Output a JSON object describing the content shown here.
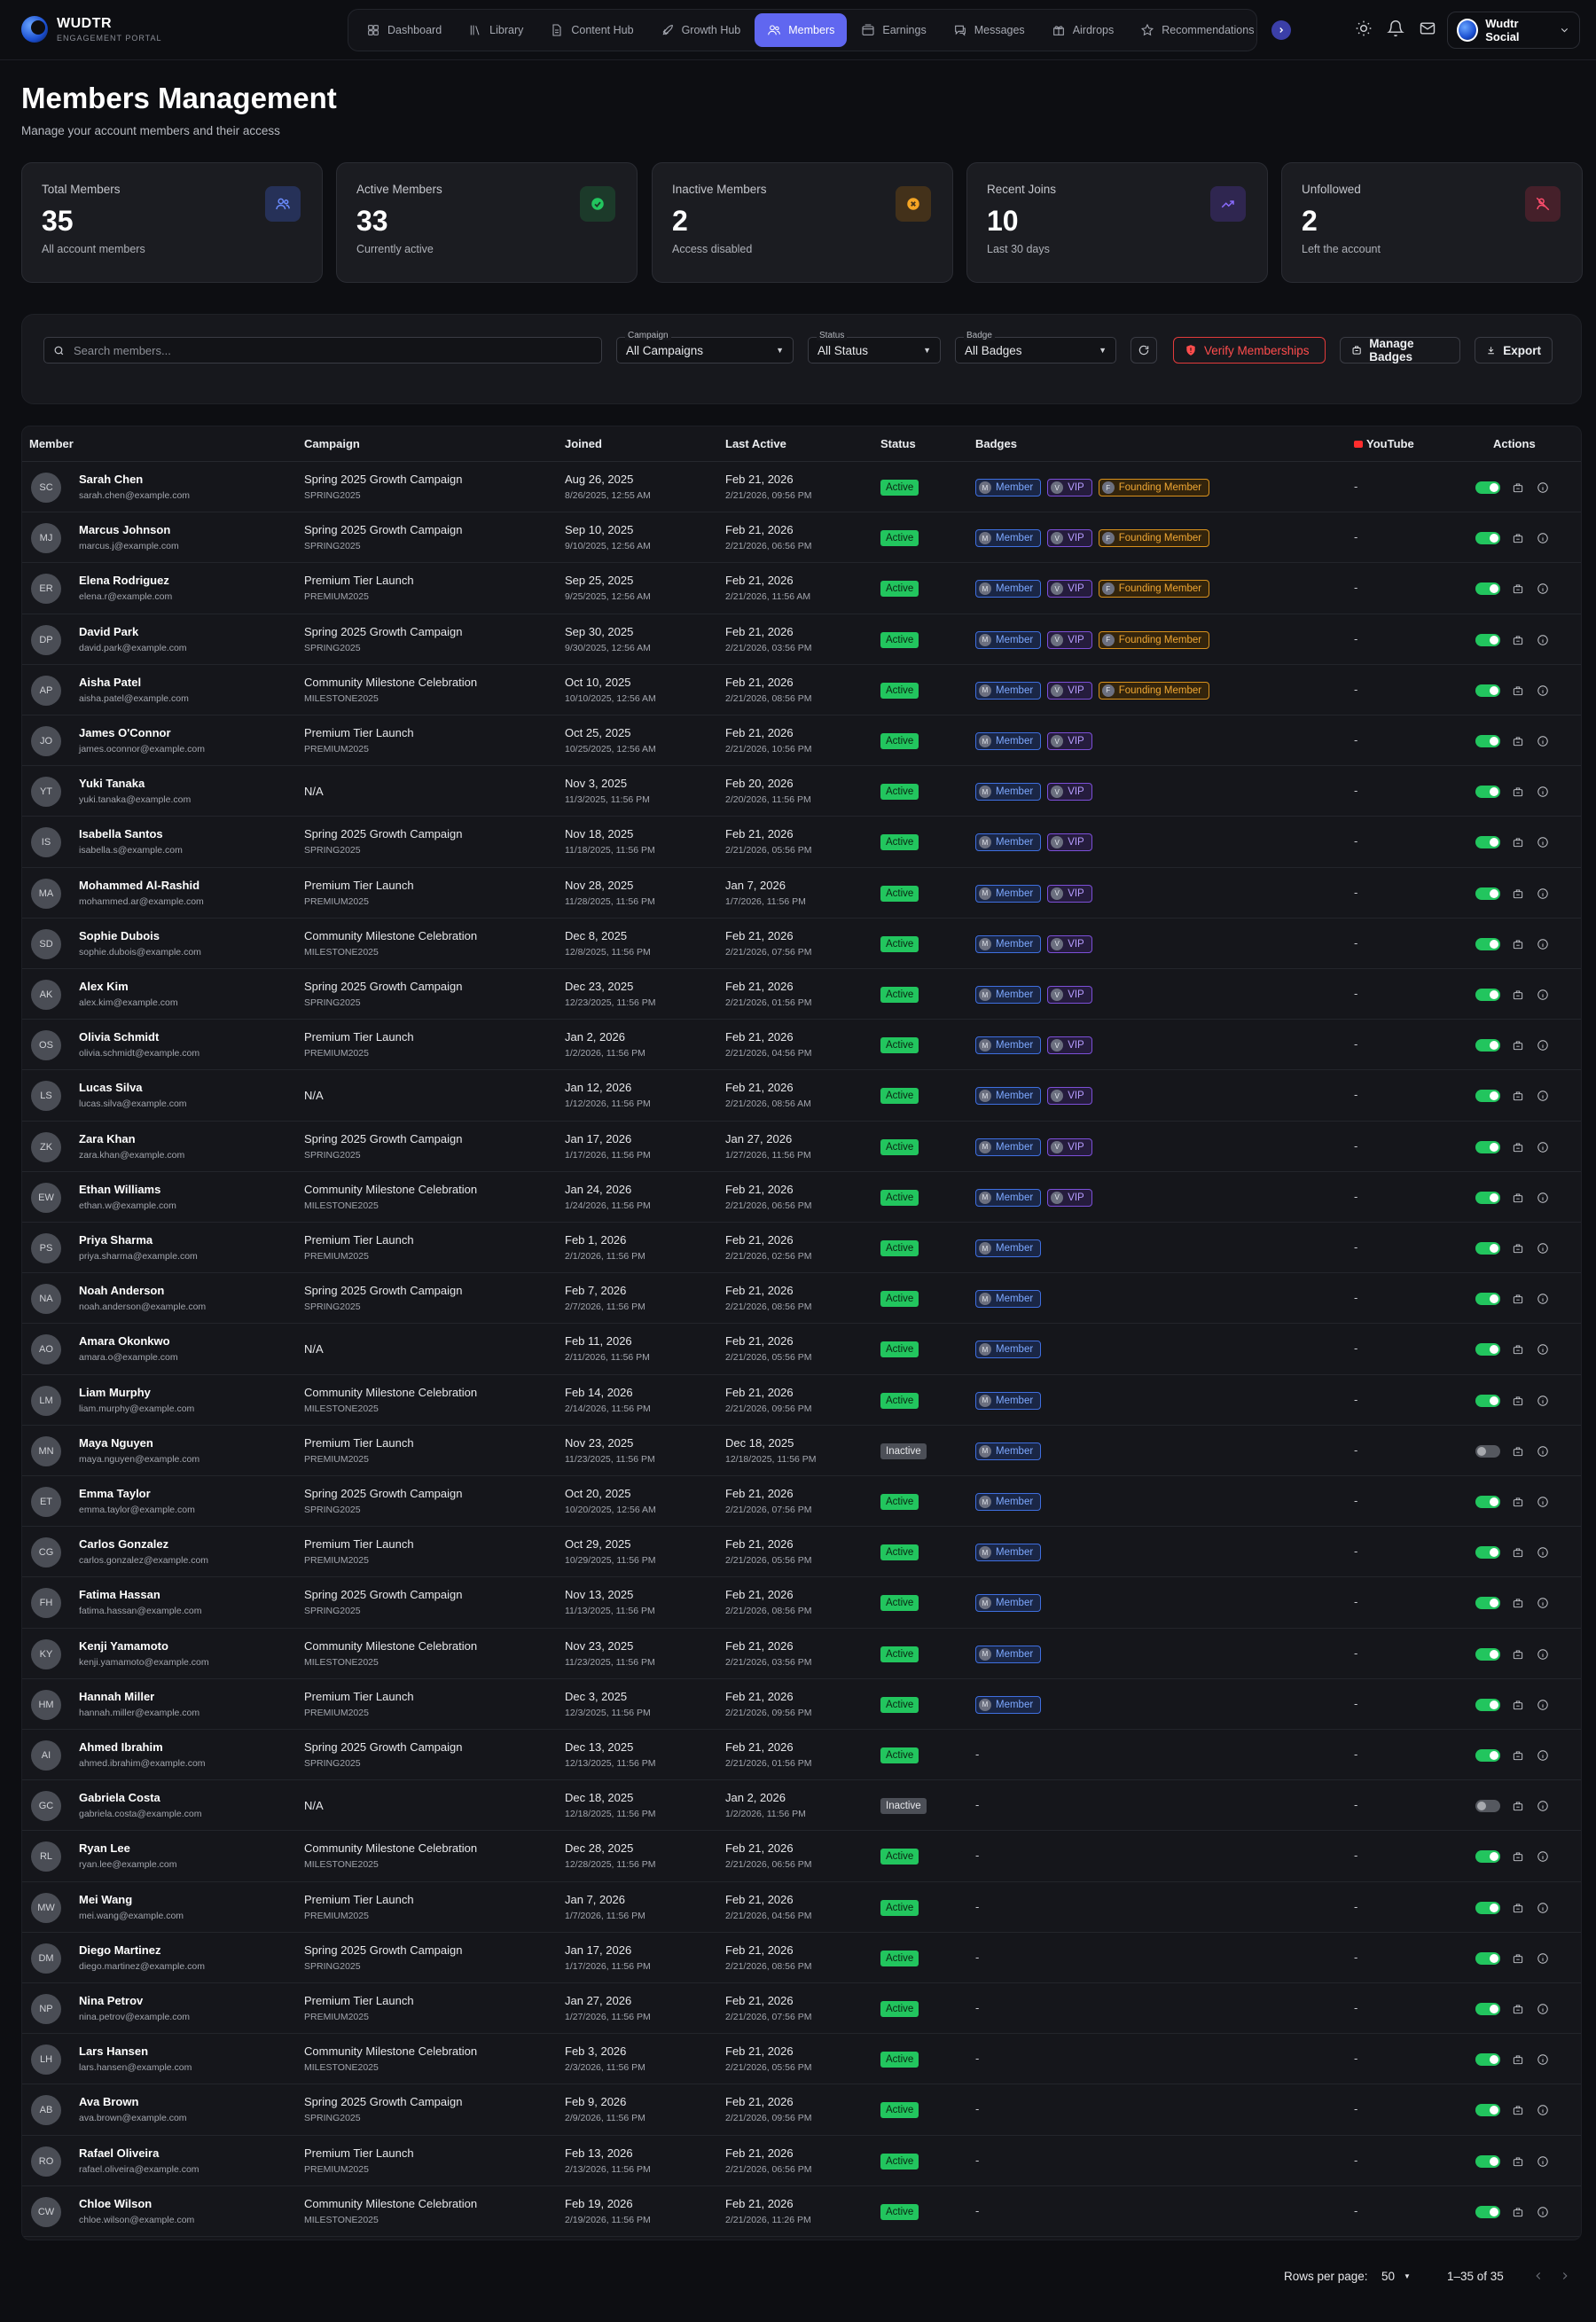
{
  "brand": {
    "name": "WUDTR",
    "tagline": "ENGAGEMENT PORTAL"
  },
  "nav": [
    {
      "label": "Dashboard",
      "icon": "grid-icon"
    },
    {
      "label": "Library",
      "icon": "library-icon"
    },
    {
      "label": "Content Hub",
      "icon": "document-icon"
    },
    {
      "label": "Growth Hub",
      "icon": "rocket-icon"
    },
    {
      "label": "Members",
      "icon": "users-icon",
      "active": true
    },
    {
      "label": "Earnings",
      "icon": "wallet-icon"
    },
    {
      "label": "Messages",
      "icon": "chat-icon"
    },
    {
      "label": "Airdrops",
      "icon": "gift-icon"
    },
    {
      "label": "Recommendations",
      "icon": "star-icon"
    }
  ],
  "account": {
    "name": "Wudtr Social"
  },
  "page": {
    "title": "Members Management",
    "subtitle": "Manage your account members and their access"
  },
  "stats": [
    {
      "label": "Total Members",
      "value": "35",
      "sub": "All account members",
      "icon": "users-icon",
      "color": "#6b8cff",
      "bg": "#263158"
    },
    {
      "label": "Active Members",
      "value": "33",
      "sub": "Currently active",
      "icon": "check-circle-icon",
      "color": "#22c55e",
      "bg": "#1c3a2a"
    },
    {
      "label": "Inactive Members",
      "value": "2",
      "sub": "Access disabled",
      "icon": "x-circle-icon",
      "color": "#f5a524",
      "bg": "#43311a"
    },
    {
      "label": "Recent Joins",
      "value": "10",
      "sub": "Last 30 days",
      "icon": "trend-up-icon",
      "color": "#8b6cff",
      "bg": "#2f2650"
    },
    {
      "label": "Unfollowed",
      "value": "2",
      "sub": "Left the account",
      "icon": "user-x-icon",
      "color": "#ff4d6d",
      "bg": "#45202a"
    }
  ],
  "filters": {
    "search_placeholder": "Search members...",
    "campaign": {
      "label": "Campaign",
      "value": "All Campaigns"
    },
    "status": {
      "label": "Status",
      "value": "All Status"
    },
    "badge": {
      "label": "Badge",
      "value": "All Badges"
    },
    "verify_label": "Verify Memberships",
    "manage_badges_label": "Manage Badges",
    "export_label": "Export"
  },
  "columns": {
    "member": "Member",
    "campaign": "Campaign",
    "joined": "Joined",
    "last_active": "Last Active",
    "status": "Status",
    "badges": "Badges",
    "youtube": "YouTube",
    "actions": "Actions"
  },
  "badge_labels": {
    "member": "Member",
    "vip": "VIP",
    "founding": "Founding Member",
    "member_initial": "M",
    "vip_initial": "V",
    "founding_initial": "F"
  },
  "rows": [
    {
      "initials": "SC",
      "name": "Sarah Chen",
      "email": "sarah.chen@example.com",
      "campaign": "Spring 2025 Growth Campaign",
      "code": "SPRING2025",
      "joined": "Aug 26, 2025",
      "joined_full": "8/26/2025, 12:55 AM",
      "last": "Feb 21, 2026",
      "last_full": "2/21/2026, 09:56 PM",
      "status": "Active",
      "badges": [
        "member",
        "vip",
        "founding"
      ],
      "youtube": "-",
      "enabled": true
    },
    {
      "initials": "MJ",
      "name": "Marcus Johnson",
      "email": "marcus.j@example.com",
      "campaign": "Spring 2025 Growth Campaign",
      "code": "SPRING2025",
      "joined": "Sep 10, 2025",
      "joined_full": "9/10/2025, 12:56 AM",
      "last": "Feb 21, 2026",
      "last_full": "2/21/2026, 06:56 PM",
      "status": "Active",
      "badges": [
        "member",
        "vip",
        "founding"
      ],
      "youtube": "-",
      "enabled": true
    },
    {
      "initials": "ER",
      "name": "Elena Rodriguez",
      "email": "elena.r@example.com",
      "campaign": "Premium Tier Launch",
      "code": "PREMIUM2025",
      "joined": "Sep 25, 2025",
      "joined_full": "9/25/2025, 12:56 AM",
      "last": "Feb 21, 2026",
      "last_full": "2/21/2026, 11:56 AM",
      "status": "Active",
      "badges": [
        "member",
        "vip",
        "founding"
      ],
      "youtube": "-",
      "enabled": true
    },
    {
      "initials": "DP",
      "name": "David Park",
      "email": "david.park@example.com",
      "campaign": "Spring 2025 Growth Campaign",
      "code": "SPRING2025",
      "joined": "Sep 30, 2025",
      "joined_full": "9/30/2025, 12:56 AM",
      "last": "Feb 21, 2026",
      "last_full": "2/21/2026, 03:56 PM",
      "status": "Active",
      "badges": [
        "member",
        "vip",
        "founding"
      ],
      "youtube": "-",
      "enabled": true
    },
    {
      "initials": "AP",
      "name": "Aisha Patel",
      "email": "aisha.patel@example.com",
      "campaign": "Community Milestone Celebration",
      "code": "MILESTONE2025",
      "joined": "Oct 10, 2025",
      "joined_full": "10/10/2025, 12:56 AM",
      "last": "Feb 21, 2026",
      "last_full": "2/21/2026, 08:56 PM",
      "status": "Active",
      "badges": [
        "member",
        "vip",
        "founding"
      ],
      "youtube": "-",
      "enabled": true
    },
    {
      "initials": "JO",
      "name": "James O'Connor",
      "email": "james.oconnor@example.com",
      "campaign": "Premium Tier Launch",
      "code": "PREMIUM2025",
      "joined": "Oct 25, 2025",
      "joined_full": "10/25/2025, 12:56 AM",
      "last": "Feb 21, 2026",
      "last_full": "2/21/2026, 10:56 PM",
      "status": "Active",
      "badges": [
        "member",
        "vip"
      ],
      "youtube": "-",
      "enabled": true
    },
    {
      "initials": "YT",
      "name": "Yuki Tanaka",
      "email": "yuki.tanaka@example.com",
      "campaign": "N/A",
      "code": "",
      "joined": "Nov 3, 2025",
      "joined_full": "11/3/2025, 11:56 PM",
      "last": "Feb 20, 2026",
      "last_full": "2/20/2026, 11:56 PM",
      "status": "Active",
      "badges": [
        "member",
        "vip"
      ],
      "youtube": "-",
      "enabled": true
    },
    {
      "initials": "IS",
      "name": "Isabella Santos",
      "email": "isabella.s@example.com",
      "campaign": "Spring 2025 Growth Campaign",
      "code": "SPRING2025",
      "joined": "Nov 18, 2025",
      "joined_full": "11/18/2025, 11:56 PM",
      "last": "Feb 21, 2026",
      "last_full": "2/21/2026, 05:56 PM",
      "status": "Active",
      "badges": [
        "member",
        "vip"
      ],
      "youtube": "-",
      "enabled": true
    },
    {
      "initials": "MA",
      "name": "Mohammed Al-Rashid",
      "email": "mohammed.ar@example.com",
      "campaign": "Premium Tier Launch",
      "code": "PREMIUM2025",
      "joined": "Nov 28, 2025",
      "joined_full": "11/28/2025, 11:56 PM",
      "last": "Jan 7, 2026",
      "last_full": "1/7/2026, 11:56 PM",
      "status": "Active",
      "badges": [
        "member",
        "vip"
      ],
      "youtube": "-",
      "enabled": true
    },
    {
      "initials": "SD",
      "name": "Sophie Dubois",
      "email": "sophie.dubois@example.com",
      "campaign": "Community Milestone Celebration",
      "code": "MILESTONE2025",
      "joined": "Dec 8, 2025",
      "joined_full": "12/8/2025, 11:56 PM",
      "last": "Feb 21, 2026",
      "last_full": "2/21/2026, 07:56 PM",
      "status": "Active",
      "badges": [
        "member",
        "vip"
      ],
      "youtube": "-",
      "enabled": true
    },
    {
      "initials": "AK",
      "name": "Alex Kim",
      "email": "alex.kim@example.com",
      "campaign": "Spring 2025 Growth Campaign",
      "code": "SPRING2025",
      "joined": "Dec 23, 2025",
      "joined_full": "12/23/2025, 11:56 PM",
      "last": "Feb 21, 2026",
      "last_full": "2/21/2026, 01:56 PM",
      "status": "Active",
      "badges": [
        "member",
        "vip"
      ],
      "youtube": "-",
      "enabled": true
    },
    {
      "initials": "OS",
      "name": "Olivia Schmidt",
      "email": "olivia.schmidt@example.com",
      "campaign": "Premium Tier Launch",
      "code": "PREMIUM2025",
      "joined": "Jan 2, 2026",
      "joined_full": "1/2/2026, 11:56 PM",
      "last": "Feb 21, 2026",
      "last_full": "2/21/2026, 04:56 PM",
      "status": "Active",
      "badges": [
        "member",
        "vip"
      ],
      "youtube": "-",
      "enabled": true
    },
    {
      "initials": "LS",
      "name": "Lucas Silva",
      "email": "lucas.silva@example.com",
      "campaign": "N/A",
      "code": "",
      "joined": "Jan 12, 2026",
      "joined_full": "1/12/2026, 11:56 PM",
      "last": "Feb 21, 2026",
      "last_full": "2/21/2026, 08:56 AM",
      "status": "Active",
      "badges": [
        "member",
        "vip"
      ],
      "youtube": "-",
      "enabled": true
    },
    {
      "initials": "ZK",
      "name": "Zara Khan",
      "email": "zara.khan@example.com",
      "campaign": "Spring 2025 Growth Campaign",
      "code": "SPRING2025",
      "joined": "Jan 17, 2026",
      "joined_full": "1/17/2026, 11:56 PM",
      "last": "Jan 27, 2026",
      "last_full": "1/27/2026, 11:56 PM",
      "status": "Active",
      "badges": [
        "member",
        "vip"
      ],
      "youtube": "-",
      "enabled": true
    },
    {
      "initials": "EW",
      "name": "Ethan Williams",
      "email": "ethan.w@example.com",
      "campaign": "Community Milestone Celebration",
      "code": "MILESTONE2025",
      "joined": "Jan 24, 2026",
      "joined_full": "1/24/2026, 11:56 PM",
      "last": "Feb 21, 2026",
      "last_full": "2/21/2026, 06:56 PM",
      "status": "Active",
      "badges": [
        "member",
        "vip"
      ],
      "youtube": "-",
      "enabled": true
    },
    {
      "initials": "PS",
      "name": "Priya Sharma",
      "email": "priya.sharma@example.com",
      "campaign": "Premium Tier Launch",
      "code": "PREMIUM2025",
      "joined": "Feb 1, 2026",
      "joined_full": "2/1/2026, 11:56 PM",
      "last": "Feb 21, 2026",
      "last_full": "2/21/2026, 02:56 PM",
      "status": "Active",
      "badges": [
        "member"
      ],
      "youtube": "-",
      "enabled": true
    },
    {
      "initials": "NA",
      "name": "Noah Anderson",
      "email": "noah.anderson@example.com",
      "campaign": "Spring 2025 Growth Campaign",
      "code": "SPRING2025",
      "joined": "Feb 7, 2026",
      "joined_full": "2/7/2026, 11:56 PM",
      "last": "Feb 21, 2026",
      "last_full": "2/21/2026, 08:56 PM",
      "status": "Active",
      "badges": [
        "member"
      ],
      "youtube": "-",
      "enabled": true
    },
    {
      "initials": "AO",
      "name": "Amara Okonkwo",
      "email": "amara.o@example.com",
      "campaign": "N/A",
      "code": "",
      "joined": "Feb 11, 2026",
      "joined_full": "2/11/2026, 11:56 PM",
      "last": "Feb 21, 2026",
      "last_full": "2/21/2026, 05:56 PM",
      "status": "Active",
      "badges": [
        "member"
      ],
      "youtube": "-",
      "enabled": true
    },
    {
      "initials": "LM",
      "name": "Liam Murphy",
      "email": "liam.murphy@example.com",
      "campaign": "Community Milestone Celebration",
      "code": "MILESTONE2025",
      "joined": "Feb 14, 2026",
      "joined_full": "2/14/2026, 11:56 PM",
      "last": "Feb 21, 2026",
      "last_full": "2/21/2026, 09:56 PM",
      "status": "Active",
      "badges": [
        "member"
      ],
      "youtube": "-",
      "enabled": true
    },
    {
      "initials": "MN",
      "name": "Maya Nguyen",
      "email": "maya.nguyen@example.com",
      "campaign": "Premium Tier Launch",
      "code": "PREMIUM2025",
      "joined": "Nov 23, 2025",
      "joined_full": "11/23/2025, 11:56 PM",
      "last": "Dec 18, 2025",
      "last_full": "12/18/2025, 11:56 PM",
      "status": "Inactive",
      "badges": [
        "member"
      ],
      "youtube": "-",
      "enabled": false
    },
    {
      "initials": "ET",
      "name": "Emma Taylor",
      "email": "emma.taylor@example.com",
      "campaign": "Spring 2025 Growth Campaign",
      "code": "SPRING2025",
      "joined": "Oct 20, 2025",
      "joined_full": "10/20/2025, 12:56 AM",
      "last": "Feb 21, 2026",
      "last_full": "2/21/2026, 07:56 PM",
      "status": "Active",
      "badges": [
        "member"
      ],
      "youtube": "-",
      "enabled": true
    },
    {
      "initials": "CG",
      "name": "Carlos Gonzalez",
      "email": "carlos.gonzalez@example.com",
      "campaign": "Premium Tier Launch",
      "code": "PREMIUM2025",
      "joined": "Oct 29, 2025",
      "joined_full": "10/29/2025, 11:56 PM",
      "last": "Feb 21, 2026",
      "last_full": "2/21/2026, 05:56 PM",
      "status": "Active",
      "badges": [
        "member"
      ],
      "youtube": "-",
      "enabled": true
    },
    {
      "initials": "FH",
      "name": "Fatima Hassan",
      "email": "fatima.hassan@example.com",
      "campaign": "Spring 2025 Growth Campaign",
      "code": "SPRING2025",
      "joined": "Nov 13, 2025",
      "joined_full": "11/13/2025, 11:56 PM",
      "last": "Feb 21, 2026",
      "last_full": "2/21/2026, 08:56 PM",
      "status": "Active",
      "badges": [
        "member"
      ],
      "youtube": "-",
      "enabled": true
    },
    {
      "initials": "KY",
      "name": "Kenji Yamamoto",
      "email": "kenji.yamamoto@example.com",
      "campaign": "Community Milestone Celebration",
      "code": "MILESTONE2025",
      "joined": "Nov 23, 2025",
      "joined_full": "11/23/2025, 11:56 PM",
      "last": "Feb 21, 2026",
      "last_full": "2/21/2026, 03:56 PM",
      "status": "Active",
      "badges": [
        "member"
      ],
      "youtube": "-",
      "enabled": true
    },
    {
      "initials": "HM",
      "name": "Hannah Miller",
      "email": "hannah.miller@example.com",
      "campaign": "Premium Tier Launch",
      "code": "PREMIUM2025",
      "joined": "Dec 3, 2025",
      "joined_full": "12/3/2025, 11:56 PM",
      "last": "Feb 21, 2026",
      "last_full": "2/21/2026, 09:56 PM",
      "status": "Active",
      "badges": [
        "member"
      ],
      "youtube": "-",
      "enabled": true
    },
    {
      "initials": "AI",
      "name": "Ahmed Ibrahim",
      "email": "ahmed.ibrahim@example.com",
      "campaign": "Spring 2025 Growth Campaign",
      "code": "SPRING2025",
      "joined": "Dec 13, 2025",
      "joined_full": "12/13/2025, 11:56 PM",
      "last": "Feb 21, 2026",
      "last_full": "2/21/2026, 01:56 PM",
      "status": "Active",
      "badges": [],
      "youtube": "-",
      "enabled": true
    },
    {
      "initials": "GC",
      "name": "Gabriela Costa",
      "email": "gabriela.costa@example.com",
      "campaign": "N/A",
      "code": "",
      "joined": "Dec 18, 2025",
      "joined_full": "12/18/2025, 11:56 PM",
      "last": "Jan 2, 2026",
      "last_full": "1/2/2026, 11:56 PM",
      "status": "Inactive",
      "badges": [],
      "youtube": "-",
      "enabled": false
    },
    {
      "initials": "RL",
      "name": "Ryan Lee",
      "email": "ryan.lee@example.com",
      "campaign": "Community Milestone Celebration",
      "code": "MILESTONE2025",
      "joined": "Dec 28, 2025",
      "joined_full": "12/28/2025, 11:56 PM",
      "last": "Feb 21, 2026",
      "last_full": "2/21/2026, 06:56 PM",
      "status": "Active",
      "badges": [],
      "youtube": "-",
      "enabled": true
    },
    {
      "initials": "MW",
      "name": "Mei Wang",
      "email": "mei.wang@example.com",
      "campaign": "Premium Tier Launch",
      "code": "PREMIUM2025",
      "joined": "Jan 7, 2026",
      "joined_full": "1/7/2026, 11:56 PM",
      "last": "Feb 21, 2026",
      "last_full": "2/21/2026, 04:56 PM",
      "status": "Active",
      "badges": [],
      "youtube": "-",
      "enabled": true
    },
    {
      "initials": "DM",
      "name": "Diego Martinez",
      "email": "diego.martinez@example.com",
      "campaign": "Spring 2025 Growth Campaign",
      "code": "SPRING2025",
      "joined": "Jan 17, 2026",
      "joined_full": "1/17/2026, 11:56 PM",
      "last": "Feb 21, 2026",
      "last_full": "2/21/2026, 08:56 PM",
      "status": "Active",
      "badges": [],
      "youtube": "-",
      "enabled": true
    },
    {
      "initials": "NP",
      "name": "Nina Petrov",
      "email": "nina.petrov@example.com",
      "campaign": "Premium Tier Launch",
      "code": "PREMIUM2025",
      "joined": "Jan 27, 2026",
      "joined_full": "1/27/2026, 11:56 PM",
      "last": "Feb 21, 2026",
      "last_full": "2/21/2026, 07:56 PM",
      "status": "Active",
      "badges": [],
      "youtube": "-",
      "enabled": true
    },
    {
      "initials": "LH",
      "name": "Lars Hansen",
      "email": "lars.hansen@example.com",
      "campaign": "Community Milestone Celebration",
      "code": "MILESTONE2025",
      "joined": "Feb 3, 2026",
      "joined_full": "2/3/2026, 11:56 PM",
      "last": "Feb 21, 2026",
      "last_full": "2/21/2026, 05:56 PM",
      "status": "Active",
      "badges": [],
      "youtube": "-",
      "enabled": true
    },
    {
      "initials": "AB",
      "name": "Ava Brown",
      "email": "ava.brown@example.com",
      "campaign": "Spring 2025 Growth Campaign",
      "code": "SPRING2025",
      "joined": "Feb 9, 2026",
      "joined_full": "2/9/2026, 11:56 PM",
      "last": "Feb 21, 2026",
      "last_full": "2/21/2026, 09:56 PM",
      "status": "Active",
      "badges": [],
      "youtube": "-",
      "enabled": true
    },
    {
      "initials": "RO",
      "name": "Rafael Oliveira",
      "email": "rafael.oliveira@example.com",
      "campaign": "Premium Tier Launch",
      "code": "PREMIUM2025",
      "joined": "Feb 13, 2026",
      "joined_full": "2/13/2026, 11:56 PM",
      "last": "Feb 21, 2026",
      "last_full": "2/21/2026, 06:56 PM",
      "status": "Active",
      "badges": [],
      "youtube": "-",
      "enabled": true
    },
    {
      "initials": "CW",
      "name": "Chloe Wilson",
      "email": "chloe.wilson@example.com",
      "campaign": "Community Milestone Celebration",
      "code": "MILESTONE2025",
      "joined": "Feb 19, 2026",
      "joined_full": "2/19/2026, 11:56 PM",
      "last": "Feb 21, 2026",
      "last_full": "2/21/2026, 11:26 PM",
      "status": "Active",
      "badges": [],
      "youtube": "-",
      "enabled": true
    }
  ],
  "empty_badges": "-",
  "pagination": {
    "rows_label": "Rows per page:",
    "rows_value": "50",
    "range": "1–35 of 35"
  }
}
